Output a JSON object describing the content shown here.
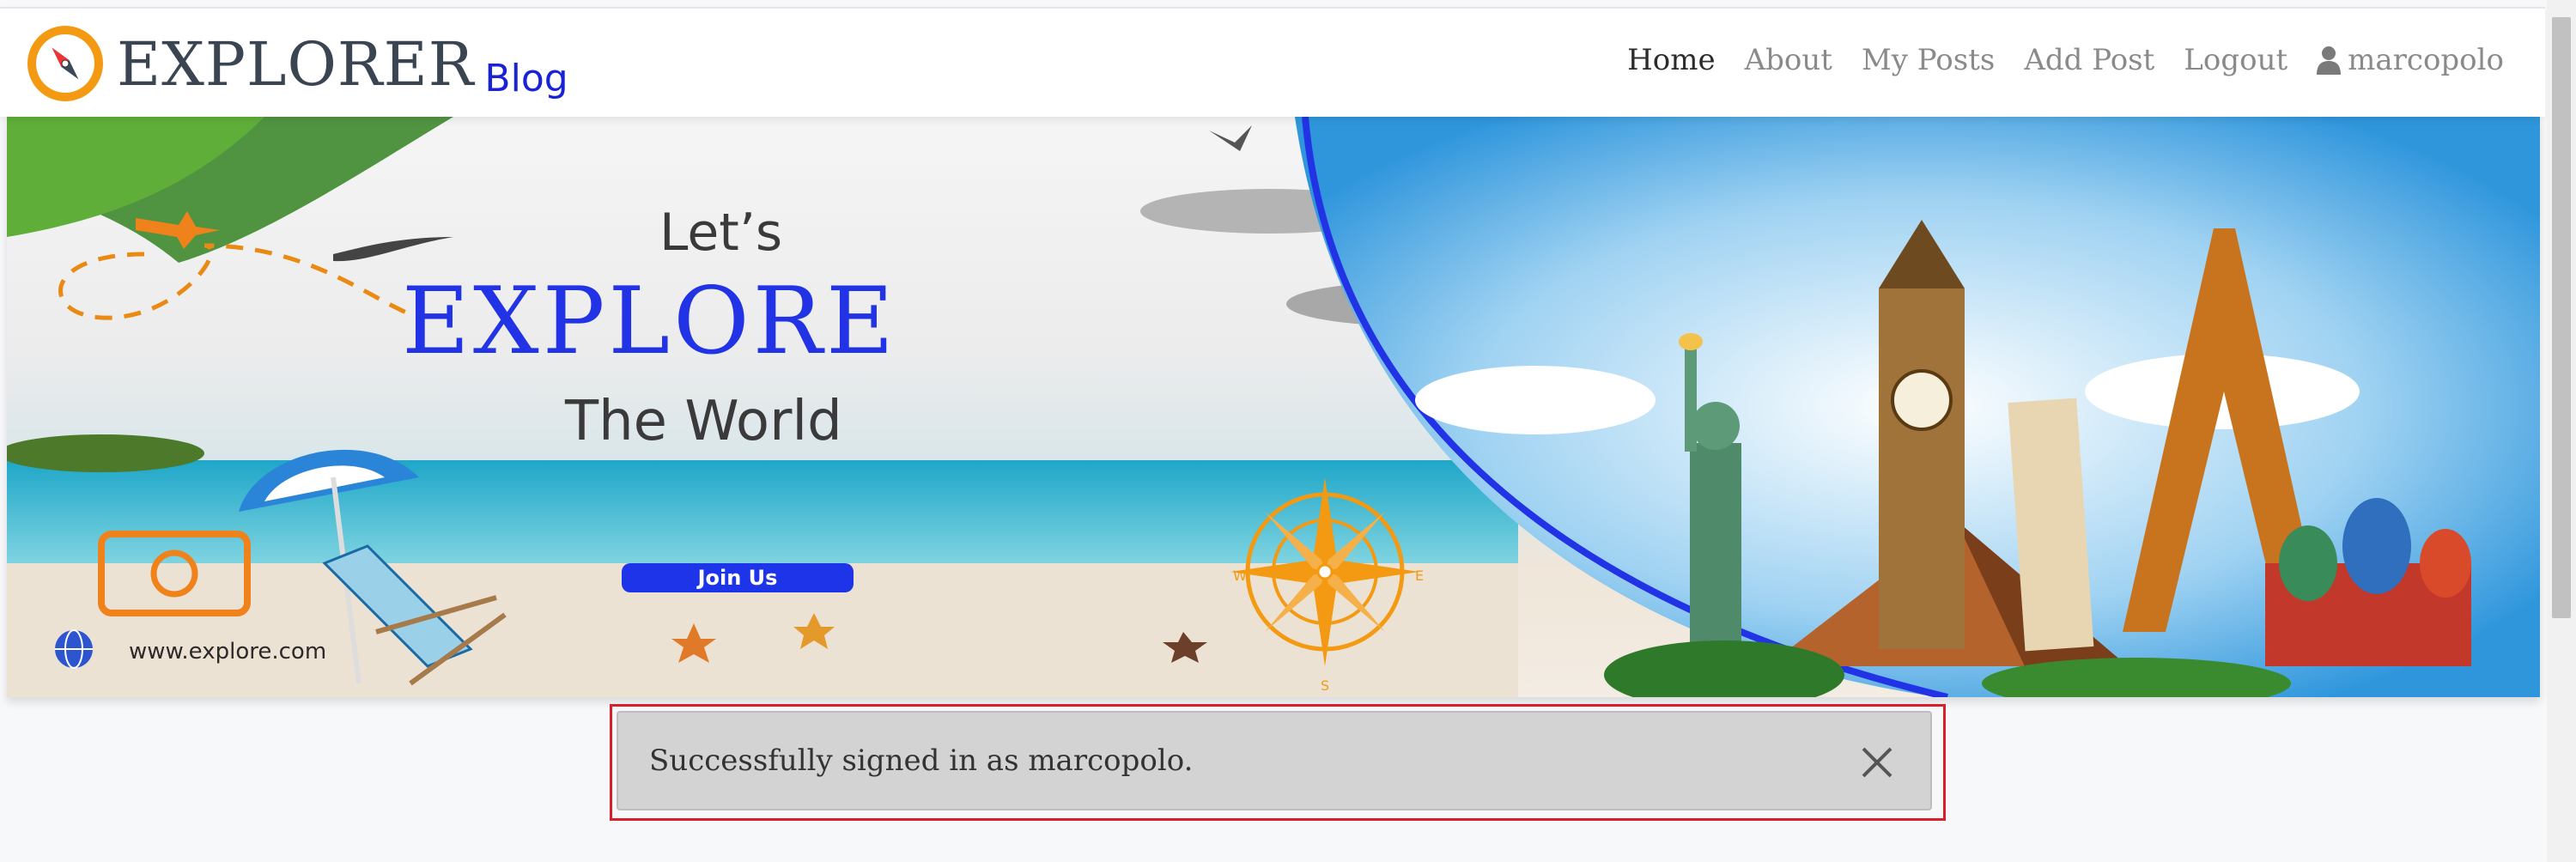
{
  "brand": {
    "name": "EXPLORER",
    "sub": "Blog"
  },
  "nav": {
    "items": [
      {
        "label": "Home",
        "active": true
      },
      {
        "label": "About",
        "active": false
      },
      {
        "label": "My Posts",
        "active": false
      },
      {
        "label": "Add Post",
        "active": false
      },
      {
        "label": "Logout",
        "active": false
      }
    ],
    "user": {
      "icon": "user-icon",
      "name": "marcopolo"
    }
  },
  "hero": {
    "line1": "Let’s",
    "line2": "EXPLORE",
    "line3": "The World",
    "button": "Join Us",
    "url": "www.explore.com",
    "compass_letters": [
      "W",
      "E",
      "S"
    ]
  },
  "alert": {
    "message": "Successfully signed in as marcopolo.",
    "close_icon": "close-icon"
  },
  "colors": {
    "brand_blue": "#1a22d6",
    "compass_orange": "#f39a12",
    "alert_bg": "#d3d3d3",
    "alert_outline": "#d91f2b"
  }
}
